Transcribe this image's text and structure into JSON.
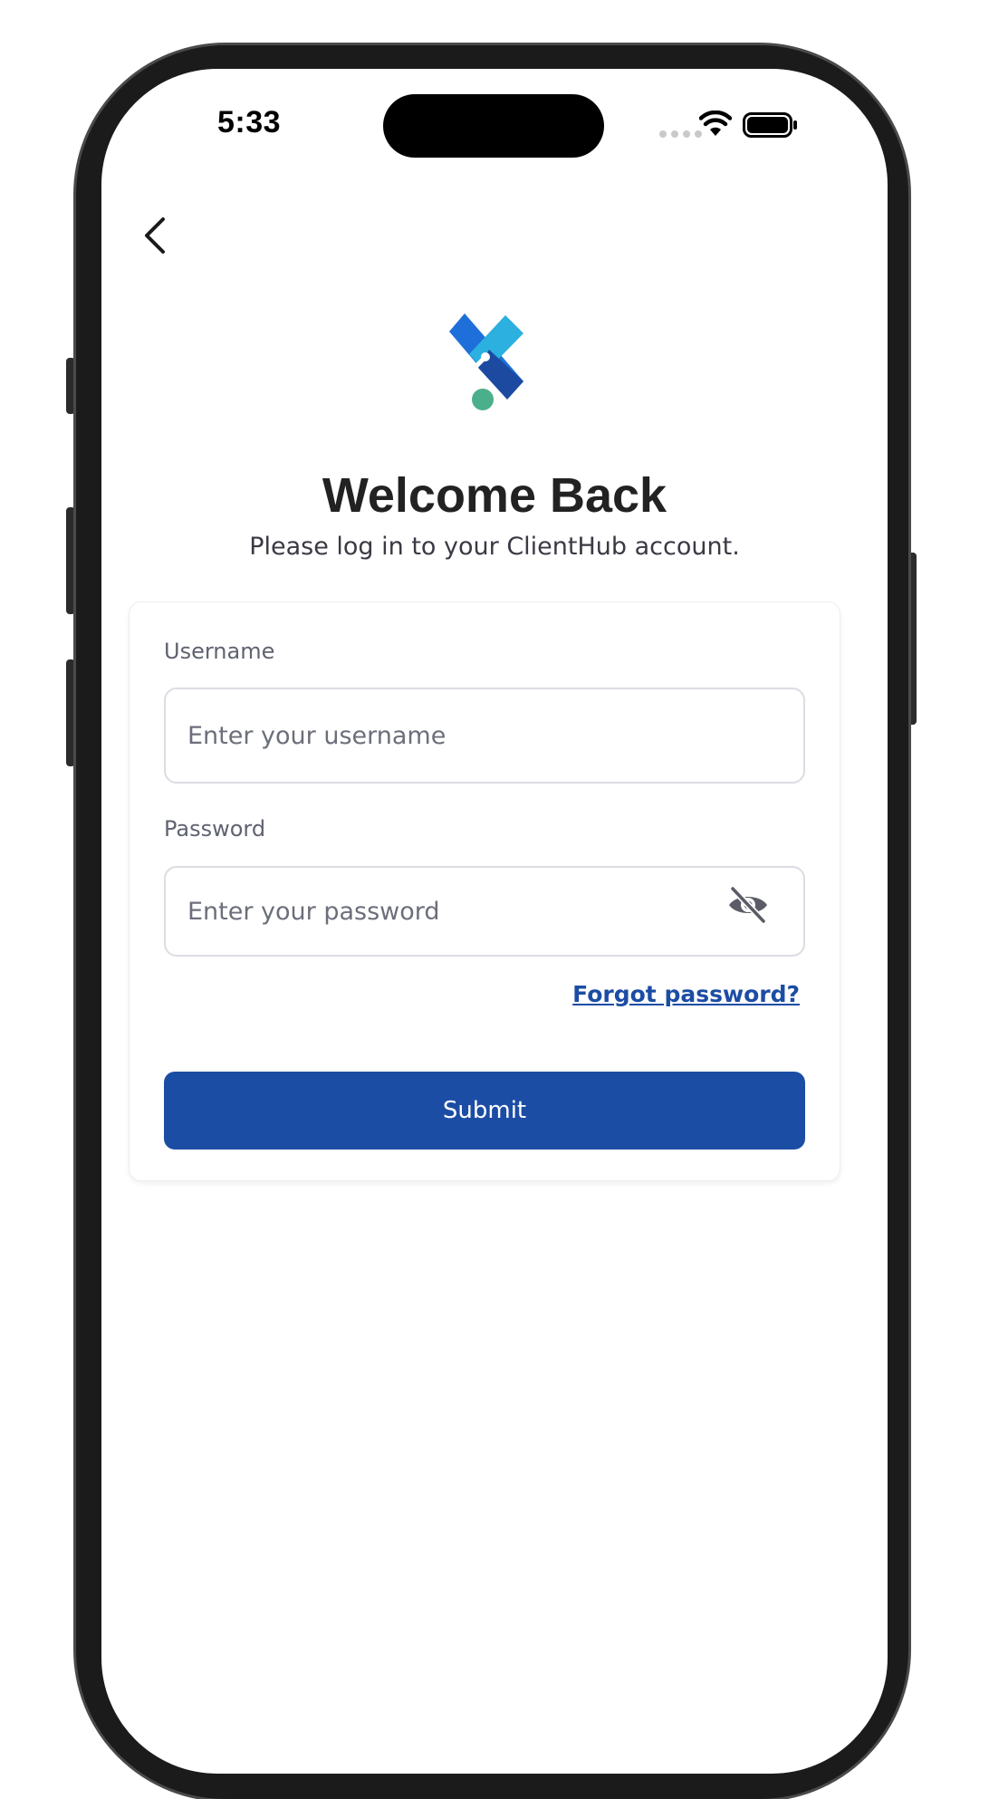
{
  "status_bar": {
    "time": "5:33"
  },
  "header": {
    "back_icon": "chevron-left-icon"
  },
  "logo": {
    "icon": "clienthub-logo-icon",
    "colors": [
      "#1e6fd9",
      "#2bb0e0",
      "#1c4aa0",
      "#4caf8c"
    ]
  },
  "main": {
    "title": "Welcome Back",
    "subtitle": "Please log in to your ClientHub account."
  },
  "form": {
    "username": {
      "label": "Username",
      "value": "",
      "placeholder": "Enter your username"
    },
    "password": {
      "label": "Password",
      "value": "",
      "placeholder": "Enter your password",
      "visibility_icon": "eye-slash-icon"
    },
    "forgot_label": "Forgot password?",
    "submit_label": "Submit"
  },
  "colors": {
    "accent": "#1c4da4",
    "text_dark": "#222222",
    "text_muted": "#6c6f7a"
  }
}
